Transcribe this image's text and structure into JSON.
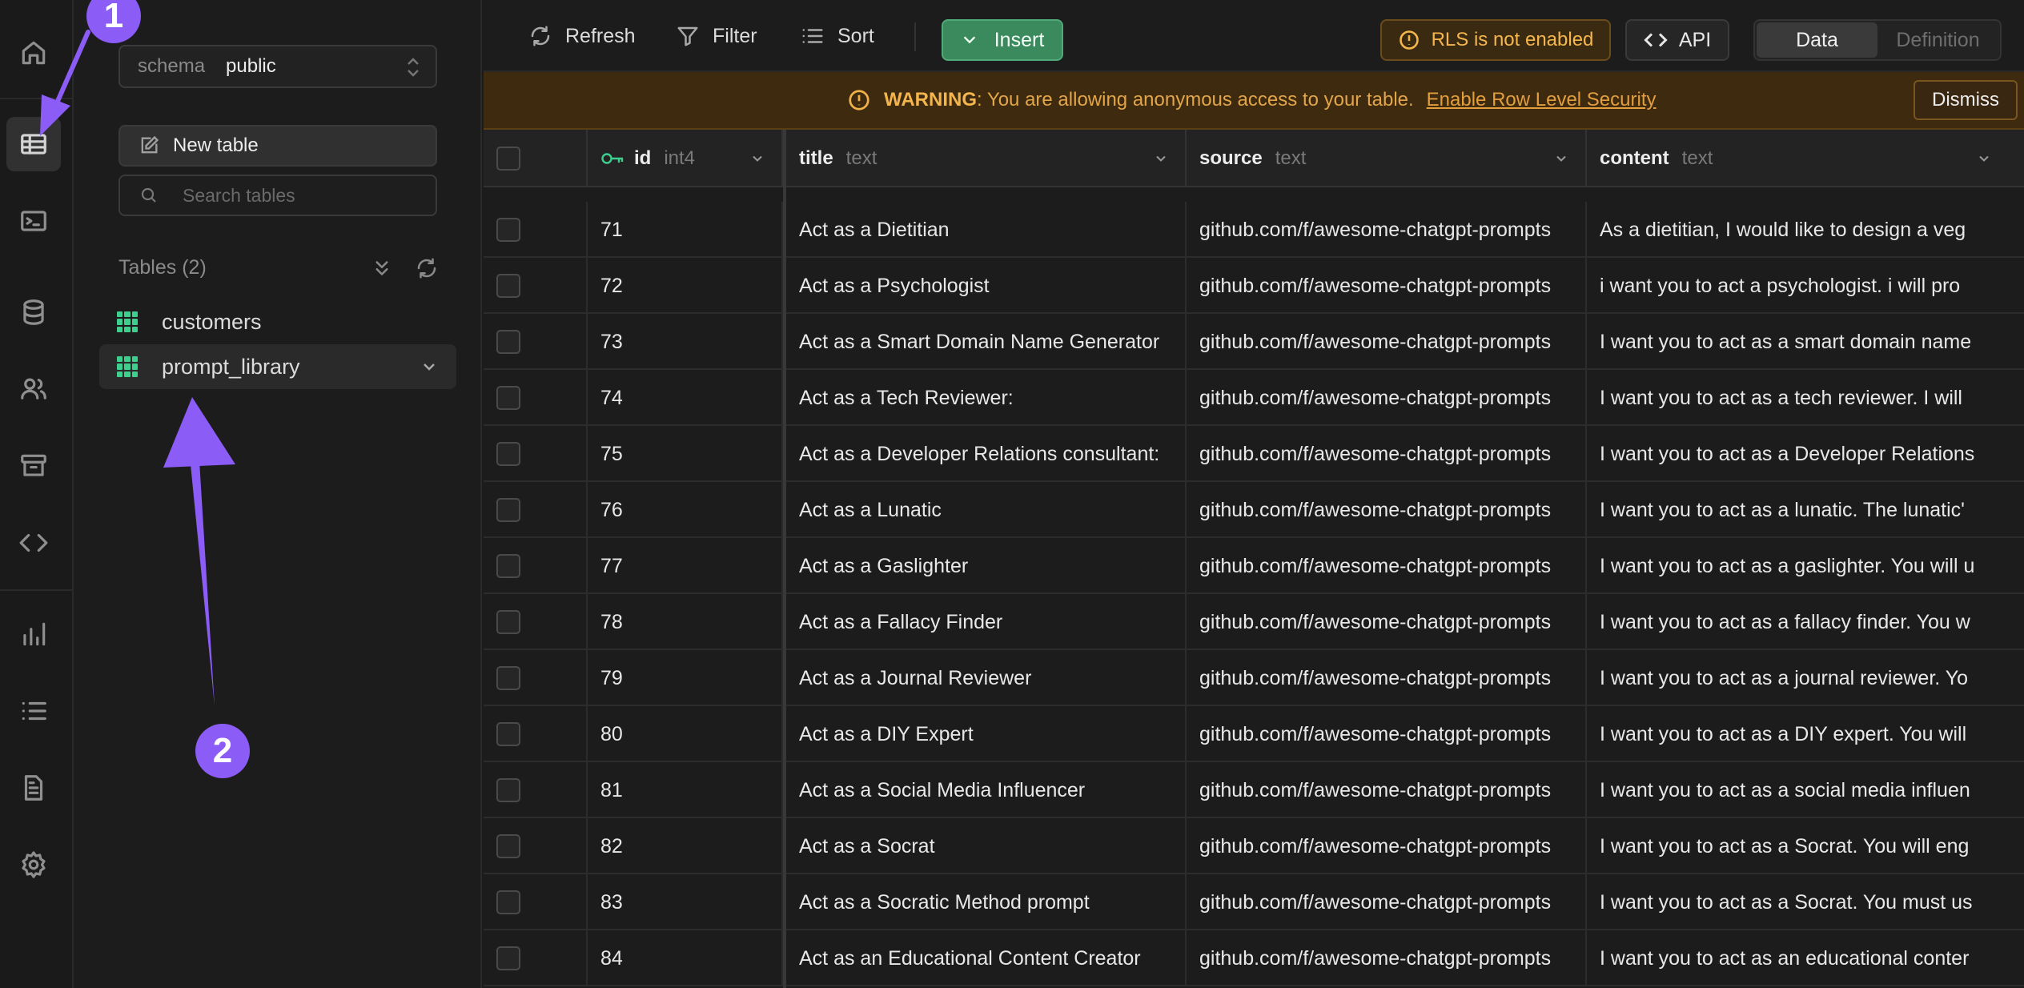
{
  "rail": {
    "icons": [
      "home-icon",
      "table-editor-icon",
      "sql-editor-icon",
      "database-icon",
      "users-icon",
      "storage-icon",
      "api-docs-icon",
      "reports-icon",
      "logs-icon",
      "docs-icon",
      "settings-icon"
    ]
  },
  "sidebar": {
    "schema_label": "schema",
    "schema_value": "public",
    "new_table_label": "New table",
    "search_placeholder": "Search tables",
    "tables_heading": "Tables (2)",
    "tables": [
      {
        "name": "customers"
      },
      {
        "name": "prompt_library"
      }
    ]
  },
  "toolbar": {
    "refresh_label": "Refresh",
    "filter_label": "Filter",
    "sort_label": "Sort",
    "insert_label": "Insert",
    "rls_label": "RLS is not enabled",
    "api_label": "API",
    "view_data": "Data",
    "view_definition": "Definition"
  },
  "warning": {
    "prefix": "WARNING",
    "message": ": You are allowing anonymous access to your table.",
    "link": "Enable Row Level Security",
    "dismiss": "Dismiss"
  },
  "grid": {
    "columns": [
      {
        "name": "id",
        "type": "int4"
      },
      {
        "name": "title",
        "type": "text"
      },
      {
        "name": "source",
        "type": "text"
      },
      {
        "name": "content",
        "type": "text"
      }
    ],
    "rows": [
      {
        "id": "71",
        "title": "Act as a Dietitian",
        "source": "github.com/f/awesome-chatgpt-prompts",
        "content": "As a dietitian, I would like to design a veg"
      },
      {
        "id": "72",
        "title": "Act as a Psychologist",
        "source": "github.com/f/awesome-chatgpt-prompts",
        "content": "i want you to act a psychologist. i will pro"
      },
      {
        "id": "73",
        "title": "Act as a Smart Domain Name Generator",
        "source": "github.com/f/awesome-chatgpt-prompts",
        "content": "I want you to act as a smart domain name"
      },
      {
        "id": "74",
        "title": "Act as a Tech Reviewer:",
        "source": "github.com/f/awesome-chatgpt-prompts",
        "content": "I want you to act as a tech reviewer. I will"
      },
      {
        "id": "75",
        "title": "Act as a Developer Relations consultant:",
        "source": "github.com/f/awesome-chatgpt-prompts",
        "content": "I want you to act as a Developer Relations"
      },
      {
        "id": "76",
        "title": "Act as a Lunatic",
        "source": "github.com/f/awesome-chatgpt-prompts",
        "content": "I want you to act as a lunatic. The lunatic'"
      },
      {
        "id": "77",
        "title": "Act as a Gaslighter",
        "source": "github.com/f/awesome-chatgpt-prompts",
        "content": "I want you to act as a gaslighter. You will u"
      },
      {
        "id": "78",
        "title": "Act as a Fallacy Finder",
        "source": "github.com/f/awesome-chatgpt-prompts",
        "content": "I want you to act as a fallacy finder. You w"
      },
      {
        "id": "79",
        "title": "Act as a Journal Reviewer",
        "source": "github.com/f/awesome-chatgpt-prompts",
        "content": "I want you to act as a journal reviewer. Yo"
      },
      {
        "id": "80",
        "title": "Act as a DIY Expert",
        "source": "github.com/f/awesome-chatgpt-prompts",
        "content": "I want you to act as a DIY expert. You will"
      },
      {
        "id": "81",
        "title": "Act as a Social Media Influencer",
        "source": "github.com/f/awesome-chatgpt-prompts",
        "content": "I want you to act as a social media influen"
      },
      {
        "id": "82",
        "title": "Act as a Socrat",
        "source": "github.com/f/awesome-chatgpt-prompts",
        "content": "I want you to act as a Socrat. You will eng"
      },
      {
        "id": "83",
        "title": "Act as a Socratic Method prompt",
        "source": "github.com/f/awesome-chatgpt-prompts",
        "content": "I want you to act as a Socrat. You must us"
      },
      {
        "id": "84",
        "title": "Act as an Educational Content Creator",
        "source": "github.com/f/awesome-chatgpt-prompts",
        "content": "I want you to act as an educational conter"
      }
    ]
  },
  "annotations": {
    "badge_1": "1",
    "badge_2": "2",
    "color": "#8b5cf6"
  },
  "colors": {
    "accent_green": "#3ecf8e",
    "insert_green": "#3b8a5d",
    "warning_amber": "#f5b64c",
    "annotation_purple": "#8b5cf6"
  }
}
